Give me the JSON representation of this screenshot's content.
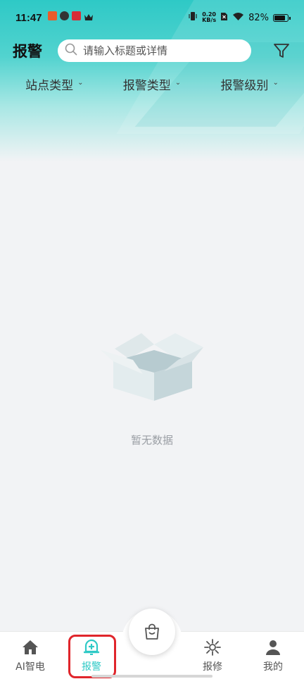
{
  "status_bar": {
    "time": "11:47",
    "net_speed_value": "0.20",
    "net_speed_unit": "KB/s",
    "battery": "82%"
  },
  "header": {
    "title": "报警",
    "search_placeholder": "请输入标题或详情"
  },
  "filters": [
    {
      "label": "站点类型"
    },
    {
      "label": "报警类型"
    },
    {
      "label": "报警级别"
    }
  ],
  "empty_state": {
    "text": "暂无数据"
  },
  "bottom_nav": {
    "items": [
      {
        "label": "AI智电",
        "icon": "home-icon"
      },
      {
        "label": "报警",
        "icon": "bell-icon",
        "active": true
      },
      {
        "label": "报修",
        "icon": "repair-icon"
      },
      {
        "label": "我的",
        "icon": "profile-icon"
      }
    ],
    "center_icon": "bag-icon"
  },
  "colors": {
    "accent": "#2ec9c6",
    "highlight_box": "#e0252b"
  }
}
